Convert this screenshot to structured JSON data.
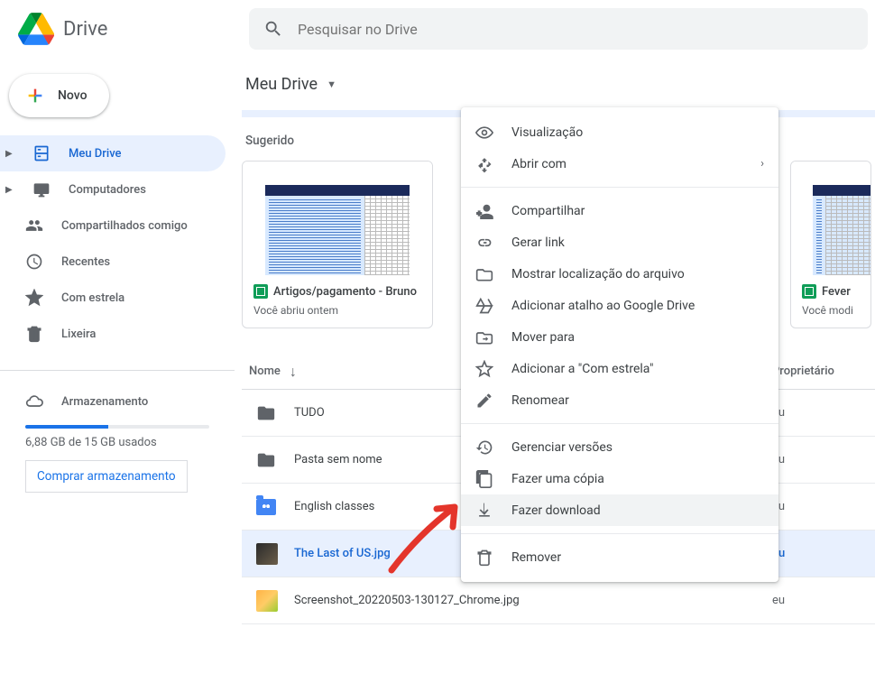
{
  "header": {
    "product": "Drive",
    "search_placeholder": "Pesquisar no Drive"
  },
  "sidebar": {
    "new_label": "Novo",
    "items": [
      {
        "label": "Meu Drive",
        "expandable": true,
        "active": true
      },
      {
        "label": "Computadores",
        "expandable": true
      },
      {
        "label": "Compartilhados comigo"
      },
      {
        "label": "Recentes"
      },
      {
        "label": "Com estrela"
      },
      {
        "label": "Lixeira"
      }
    ],
    "storage_label": "Armazenamento",
    "storage_text": "6,88 GB de 15 GB usados",
    "buy_label": "Comprar armazenamento"
  },
  "main": {
    "title": "Meu Drive",
    "suggested_label": "Sugerido",
    "cards": [
      {
        "title": "Artigos/pagamento - Bruno",
        "sub": "Você abriu ontem"
      },
      {
        "title": "Fever",
        "sub": "Você modi"
      }
    ],
    "columns": {
      "name": "Nome",
      "owner": "Proprietário"
    },
    "rows": [
      {
        "name": "TUDO",
        "owner": "eu",
        "type": "folder"
      },
      {
        "name": "Pasta sem nome",
        "owner": "eu",
        "type": "folder"
      },
      {
        "name": "English classes",
        "owner": "eu",
        "type": "shared-folder"
      },
      {
        "name": "The Last of US.jpg",
        "owner": "eu",
        "type": "image",
        "selected": true
      },
      {
        "name": "Screenshot_20220503-130127_Chrome.jpg",
        "owner": "eu",
        "type": "image-orange"
      }
    ]
  },
  "context_menu": [
    {
      "label": "Visualização",
      "icon": "eye"
    },
    {
      "label": "Abrir com",
      "icon": "open-with",
      "submenu": true
    },
    {
      "sep": true
    },
    {
      "label": "Compartilhar",
      "icon": "person-add"
    },
    {
      "label": "Gerar link",
      "icon": "link"
    },
    {
      "label": "Mostrar localização do arquivo",
      "icon": "folder-open"
    },
    {
      "label": "Adicionar atalho ao Google Drive",
      "icon": "drive-add"
    },
    {
      "label": "Mover para",
      "icon": "folder-move"
    },
    {
      "label": "Adicionar a \"Com estrela\"",
      "icon": "star"
    },
    {
      "label": "Renomear",
      "icon": "pencil"
    },
    {
      "sep": true
    },
    {
      "label": "Gerenciar versões",
      "icon": "history"
    },
    {
      "label": "Fazer uma cópia",
      "icon": "copy"
    },
    {
      "label": "Fazer download",
      "icon": "download",
      "hover": true
    },
    {
      "sep": true
    },
    {
      "label": "Remover",
      "icon": "trash"
    }
  ]
}
